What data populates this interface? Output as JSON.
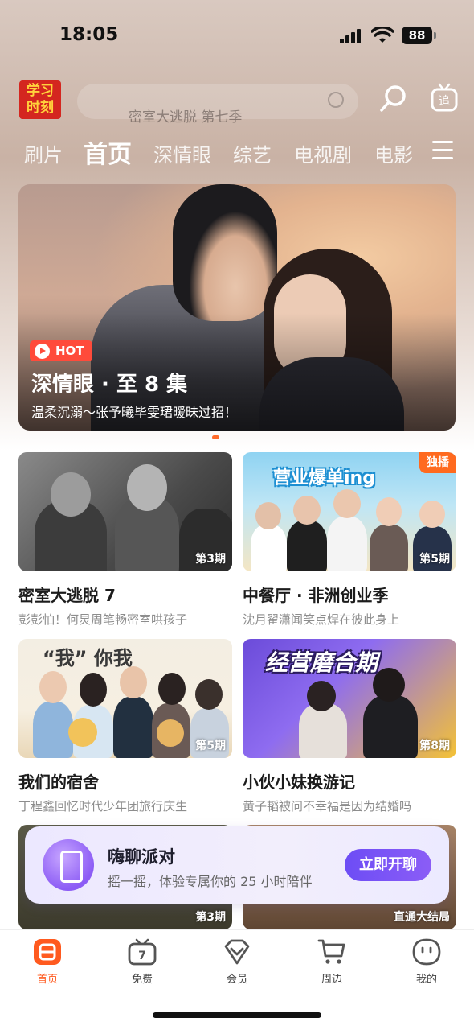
{
  "status_bar": {
    "time": "18:05",
    "battery": "88"
  },
  "header": {
    "logo_text_line1": "学习",
    "logo_text_line2": "时刻",
    "search_placeholder": "密室大逃脱 第七季",
    "tv_label": "追"
  },
  "tabs": [
    {
      "label": "刷片"
    },
    {
      "label": "首页"
    },
    {
      "label": "深情眼"
    },
    {
      "label": "综艺"
    },
    {
      "label": "电视剧"
    },
    {
      "label": "电影"
    }
  ],
  "banner": {
    "badge": "HOT",
    "title": "深情眼 · 至 8 集",
    "subtitle": "温柔沉溺～张予曦毕雯珺暧昧过招！"
  },
  "cards": [
    {
      "title": "密室大逃脱 7",
      "desc": "彭彭怕！何炅周笔畅密室哄孩子",
      "episode": "第3期"
    },
    {
      "title": "中餐厅 · 非洲创业季",
      "desc": "沈月翟潇闻笑点焊在彼此身上",
      "episode": "第5期",
      "tag": "独播",
      "logo": "营业爆单ing"
    },
    {
      "title": "我们的宿舍",
      "desc": "丁程鑫回忆时代少年团旅行庆生",
      "episode": "第5期",
      "logo": "“我” 你我"
    },
    {
      "title": "小伙小妹换游记",
      "desc": "黄子韬被问不幸福是因为结婚吗",
      "episode": "第8期",
      "logo": "经营磨合期"
    },
    {
      "episode": "第3期"
    },
    {
      "episode": "直通大结局"
    }
  ],
  "promo": {
    "title": "嗨聊派对",
    "desc": "摇一摇，体验专属你的 25 小时陪伴",
    "button": "立即开聊"
  },
  "bottom_nav": [
    {
      "label": "首页",
      "icon": "home-icon",
      "active": true
    },
    {
      "label": "免费",
      "icon": "free-tv-icon"
    },
    {
      "label": "会员",
      "icon": "vip-diamond-icon"
    },
    {
      "label": "周边",
      "icon": "shopping-cart-icon"
    },
    {
      "label": "我的",
      "icon": "profile-face-icon"
    }
  ],
  "colors": {
    "accent": "#ff5a1f",
    "hot": "#ff4b3b",
    "promo_button": "#6d4df5"
  }
}
